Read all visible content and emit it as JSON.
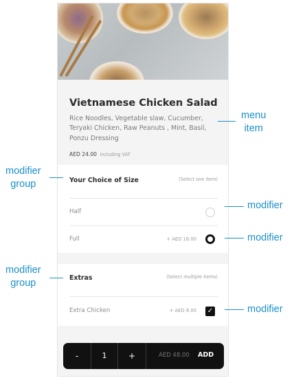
{
  "menu_item": {
    "name": "Vietnamese Chicken Salad",
    "description": "Rice Noodles, Vegetable slaw, Cucumber, Teryaki Chicken, Raw Peanuts , Mint, Basil, Ponzu Dressing",
    "price": "AED 24.00",
    "price_note": "including VAT",
    "image_icon": "salad-photo"
  },
  "size_group": {
    "title": "Your Choice of Size",
    "hint": "(Select one item)",
    "options": [
      {
        "label": "Half",
        "price": "",
        "selected": false
      },
      {
        "label": "Full",
        "price": "+ AED 16.00",
        "selected": true
      }
    ]
  },
  "extras_group": {
    "title": "Extras",
    "hint": "(Select multiple items)",
    "options": [
      {
        "label": "Extra Chicken",
        "price": "+ AED 8.00",
        "checked": true
      }
    ]
  },
  "cart_bar": {
    "minus": "-",
    "quantity": "1",
    "plus": "+",
    "total": "AED  48.00",
    "add_label": "ADD"
  },
  "annotations": {
    "menu_item": "menu\nitem",
    "modifier_group": "modifier\ngroup",
    "modifier": "modifier"
  },
  "colors": {
    "annotation": "#1a8fc9",
    "selected_control": "#111111",
    "panel_background": "#f4f4f5"
  }
}
